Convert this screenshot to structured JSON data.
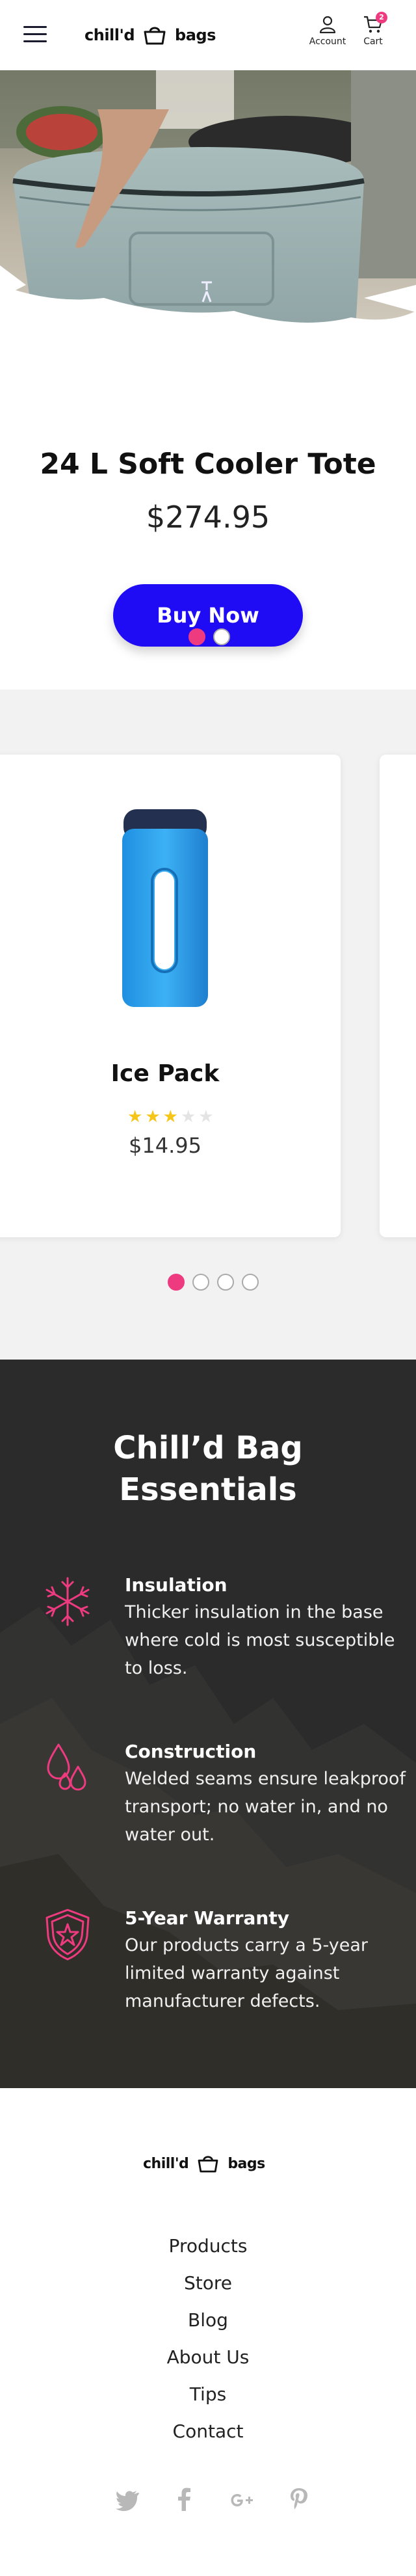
{
  "header": {
    "logo_left": "chill'd",
    "logo_right": "bags",
    "account_label": "Account",
    "cart_label": "Cart",
    "cart_count": "2"
  },
  "hero": {
    "title": "24 L Soft Cooler Tote",
    "price": "$274.95",
    "cta": "Buy Now",
    "slide_active": 1,
    "slide_count": 2
  },
  "products": {
    "items": [
      {
        "name": "Ice Pack",
        "price": "$14.95",
        "rating": 3,
        "rating_max": 5
      }
    ],
    "slide_active": 1,
    "slide_count": 4
  },
  "essentials": {
    "title_line1": "Chill’d Bag",
    "title_line2": "Essentials",
    "features": [
      {
        "icon": "snowflake-icon",
        "title": "Insulation",
        "body": "Thicker insulation in the base where cold is most susceptible to loss."
      },
      {
        "icon": "water-drops-icon",
        "title": "Construction",
        "body": "Welded seams ensure leakproof transport; no water in, and no water out."
      },
      {
        "icon": "shield-star-icon",
        "title": "5-Year Warranty",
        "body": "Our products carry a 5-year limited warranty against manufacturer defects."
      }
    ]
  },
  "footer": {
    "logo_left": "chill'd",
    "logo_right": "bags",
    "links": [
      "Products",
      "Store",
      "Blog",
      "About Us",
      "Tips",
      "Contact"
    ],
    "social": [
      "twitter-icon",
      "facebook-icon",
      "google-plus-icon",
      "pinterest-icon"
    ]
  },
  "colors": {
    "accent_pink": "#ee3b80",
    "button_blue": "#1f0cf5",
    "star_yellow": "#f5c518",
    "dark_section": "#2f2f30"
  }
}
